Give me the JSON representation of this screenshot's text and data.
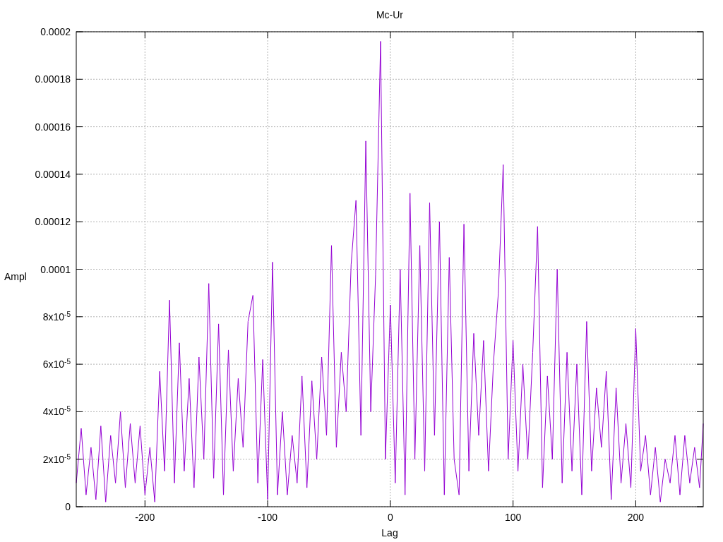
{
  "chart_data": {
    "type": "line",
    "title": "Mc-Ur",
    "xlabel": "Lag",
    "ylabel": "Ampl",
    "xlim": [
      -256,
      255
    ],
    "ylim": [
      0,
      0.0002
    ],
    "grid": true,
    "xticks": [
      -200,
      -100,
      0,
      100,
      200
    ],
    "yticks": [
      0,
      {
        "value": 2e-05,
        "label": "2x10$^{-5}$"
      },
      {
        "value": 4e-05,
        "label": "4x10$^{-5}$"
      },
      {
        "value": 6e-05,
        "label": "6x10$^{-5}$"
      },
      {
        "value": 8e-05,
        "label": "8x10$^{-5}$"
      },
      0.0001,
      0.00012,
      0.00014,
      0.00016,
      0.00018,
      0.0002
    ],
    "x": [
      -256,
      -252,
      -248,
      -244,
      -240,
      -236,
      -232,
      -228,
      -224,
      -220,
      -216,
      -212,
      -208,
      -204,
      -200,
      -196,
      -192,
      -188,
      -184,
      -180,
      -176,
      -172,
      -168,
      -164,
      -160,
      -156,
      -152,
      -148,
      -144,
      -140,
      -136,
      -132,
      -128,
      -124,
      -120,
      -116,
      -112,
      -108,
      -104,
      -100,
      -96,
      -92,
      -88,
      -84,
      -80,
      -76,
      -72,
      -68,
      -64,
      -60,
      -56,
      -52,
      -48,
      -44,
      -40,
      -36,
      -32,
      -28,
      -24,
      -20,
      -16,
      -12,
      -8,
      -4,
      0,
      4,
      8,
      12,
      16,
      20,
      24,
      28,
      32,
      36,
      40,
      44,
      48,
      52,
      56,
      60,
      64,
      68,
      72,
      76,
      80,
      84,
      88,
      92,
      96,
      100,
      104,
      108,
      112,
      116,
      120,
      124,
      128,
      132,
      136,
      140,
      144,
      148,
      152,
      156,
      160,
      164,
      168,
      172,
      176,
      180,
      184,
      188,
      192,
      196,
      200,
      204,
      208,
      212,
      216,
      220,
      224,
      228,
      232,
      236,
      240,
      244,
      248,
      252,
      255
    ],
    "series": [
      {
        "color": "#9400d3",
        "values": [
          1e-05,
          3.3e-05,
          5e-06,
          2.5e-05,
          3e-06,
          3.4e-05,
          2e-06,
          3e-05,
          1e-05,
          4e-05,
          8e-06,
          3.5e-05,
          1e-05,
          3.4e-05,
          5e-06,
          2.5e-05,
          2e-06,
          5.7e-05,
          1.5e-05,
          8.7e-05,
          1e-05,
          6.9e-05,
          1.5e-05,
          5.4e-05,
          8e-06,
          6.3e-05,
          2e-05,
          9.4e-05,
          1.2e-05,
          7.7e-05,
          5e-06,
          6.6e-05,
          1.5e-05,
          5.4e-05,
          2.5e-05,
          7.8e-05,
          8.9e-05,
          1e-05,
          6.2e-05,
          3e-06,
          0.000103,
          5e-06,
          4e-05,
          5e-06,
          3e-05,
          1e-05,
          5.5e-05,
          8e-06,
          5.3e-05,
          2e-05,
          6.3e-05,
          3e-05,
          0.00011,
          2.5e-05,
          6.5e-05,
          4e-05,
          0.000102,
          0.000129,
          3e-05,
          0.000154,
          4e-05,
          9.8e-05,
          0.000196,
          2e-05,
          8.5e-05,
          1e-05,
          0.0001,
          5e-06,
          0.000132,
          2e-05,
          0.00011,
          1.5e-05,
          0.000128,
          3e-05,
          0.00012,
          5e-06,
          0.000105,
          2e-05,
          5e-06,
          0.000119,
          1.5e-05,
          7.3e-05,
          3e-05,
          7e-05,
          1.5e-05,
          6e-05,
          9e-05,
          0.000144,
          2e-05,
          7e-05,
          1.5e-05,
          6e-05,
          2e-05,
          6.5e-05,
          0.000118,
          8e-06,
          5.5e-05,
          2e-05,
          0.0001,
          1e-05,
          6.5e-05,
          1.5e-05,
          6e-05,
          5e-06,
          7.8e-05,
          1.5e-05,
          5e-05,
          2.5e-05,
          5.7e-05,
          3e-06,
          5e-05,
          1e-05,
          3.5e-05,
          8e-06,
          7.5e-05,
          1.5e-05,
          3e-05,
          5e-06,
          2.5e-05,
          2e-06,
          2e-05,
          1e-05,
          3e-05,
          5e-06,
          3e-05,
          1e-05,
          2.5e-05,
          8e-06,
          3.5e-05
        ]
      }
    ]
  }
}
